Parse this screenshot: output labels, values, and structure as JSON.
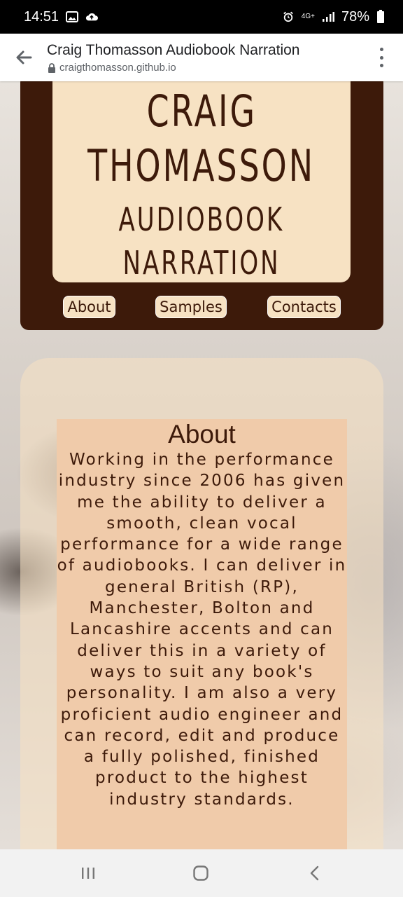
{
  "status_bar": {
    "time": "14:51",
    "signal": "4G+",
    "battery": "78%",
    "icons": [
      "image-icon",
      "cloud-upload-icon",
      "alarm-icon",
      "network-icon",
      "signal-icon",
      "battery-icon"
    ]
  },
  "browser": {
    "page_title": "Craig Thomasson Audiobook Narration",
    "url": "craigthomasson.github.io"
  },
  "header": {
    "title_line1": "CRAIG",
    "title_line2": "THOMASSON",
    "title_line3": "AUDIOBOOK",
    "title_line4": "NARRATION",
    "nav": {
      "about": "About",
      "samples": "Samples",
      "contacts": "Contacts"
    }
  },
  "about": {
    "heading": "About",
    "body": "Working in the performance industry since 2006 has given me the ability to deliver a smooth, clean vocal performance for a wide range of audiobooks. I can deliver in general British (RP), Manchester, Bolton and Lancashire accents and can deliver this in a variety of ways to suit any book's personality. I am also a very proficient audio engineer and can record, edit and produce a fully polished, finished product to the highest industry standards."
  },
  "colors": {
    "brown": "#3d1a0a",
    "cream": "#f7e2c3",
    "peach": "#f0cbaa"
  }
}
